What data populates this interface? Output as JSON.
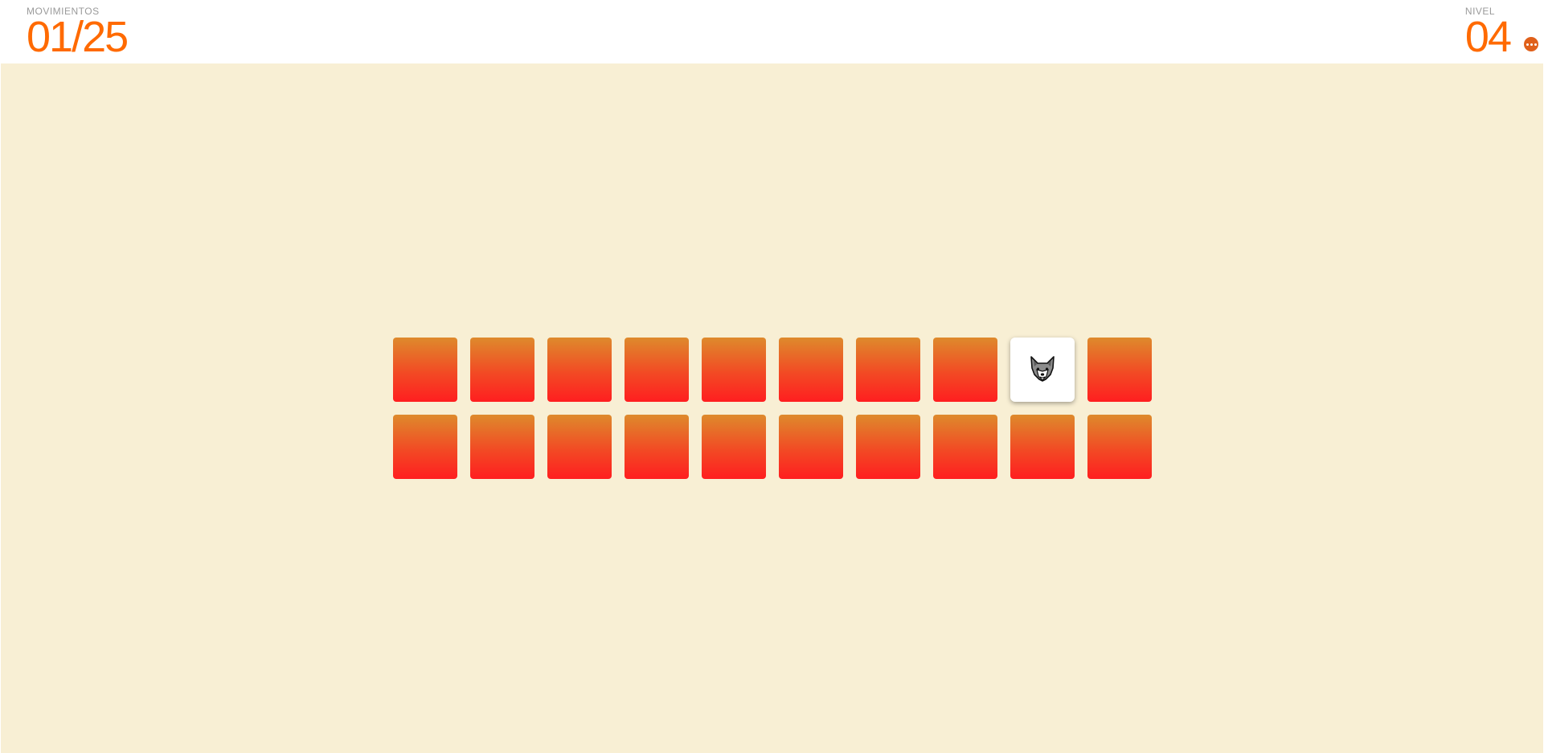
{
  "header": {
    "moves_label": "MOVIMIENTOS",
    "moves_value": "01/25",
    "level_label": "NIVEL",
    "level_value": "04",
    "menu_icon": "more-dots-icon"
  },
  "colors": {
    "accent": "#ff6a00",
    "board_background": "#f8efd4",
    "card_top": "#de8a2c",
    "card_bottom": "#ff1e20",
    "revealed_card": "#ffffff"
  },
  "board": {
    "rows": 2,
    "columns": 10,
    "cards": [
      {
        "state": "hidden"
      },
      {
        "state": "hidden"
      },
      {
        "state": "hidden"
      },
      {
        "state": "hidden"
      },
      {
        "state": "hidden"
      },
      {
        "state": "hidden"
      },
      {
        "state": "hidden"
      },
      {
        "state": "hidden"
      },
      {
        "state": "revealed",
        "icon": "wolf-icon"
      },
      {
        "state": "hidden"
      },
      {
        "state": "hidden"
      },
      {
        "state": "hidden"
      },
      {
        "state": "hidden"
      },
      {
        "state": "hidden"
      },
      {
        "state": "hidden"
      },
      {
        "state": "hidden"
      },
      {
        "state": "hidden"
      },
      {
        "state": "hidden"
      },
      {
        "state": "hidden"
      },
      {
        "state": "hidden"
      }
    ]
  }
}
